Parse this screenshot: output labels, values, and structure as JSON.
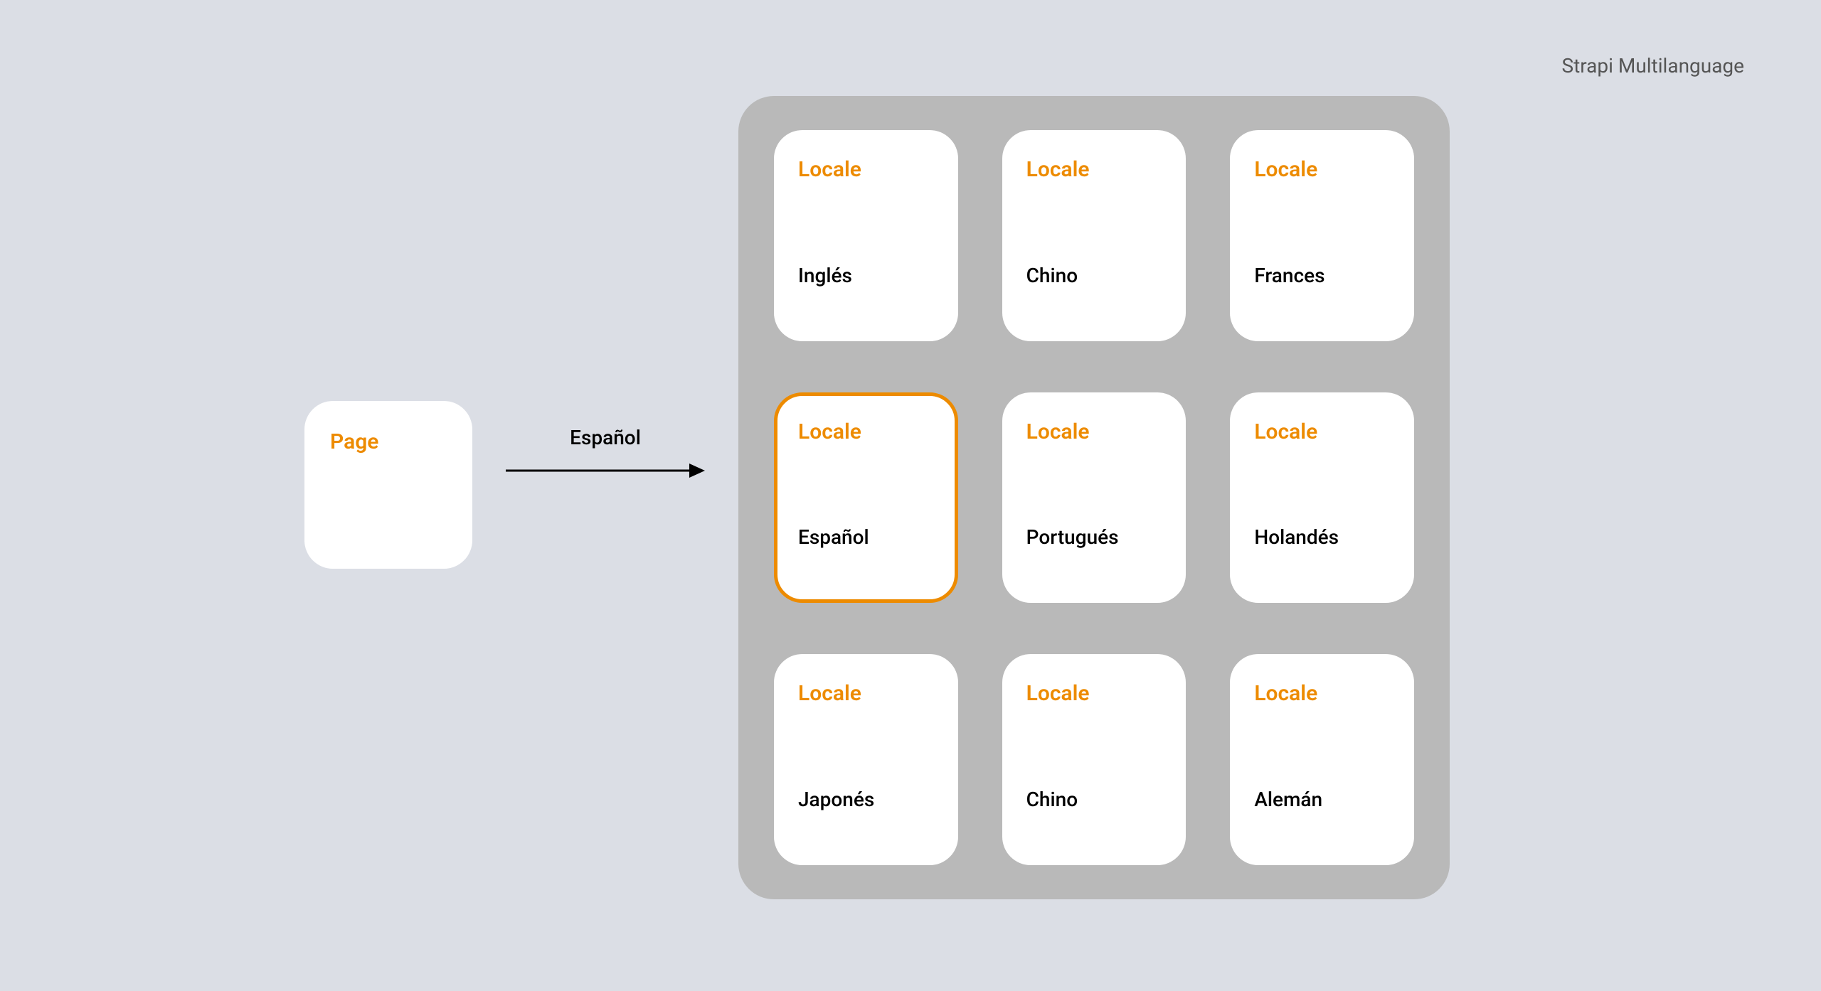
{
  "header": {
    "label": "Strapi Multilanguage"
  },
  "page": {
    "title": "Page"
  },
  "arrow": {
    "label": "Español"
  },
  "locale": {
    "card_label": "Locale",
    "selected_index": 3,
    "items": [
      {
        "value": "Inglés"
      },
      {
        "value": "Chino"
      },
      {
        "value": "Frances"
      },
      {
        "value": "Español"
      },
      {
        "value": "Portugués"
      },
      {
        "value": "Holandés"
      },
      {
        "value": "Japonés"
      },
      {
        "value": "Chino"
      },
      {
        "value": "Alemán"
      }
    ]
  }
}
